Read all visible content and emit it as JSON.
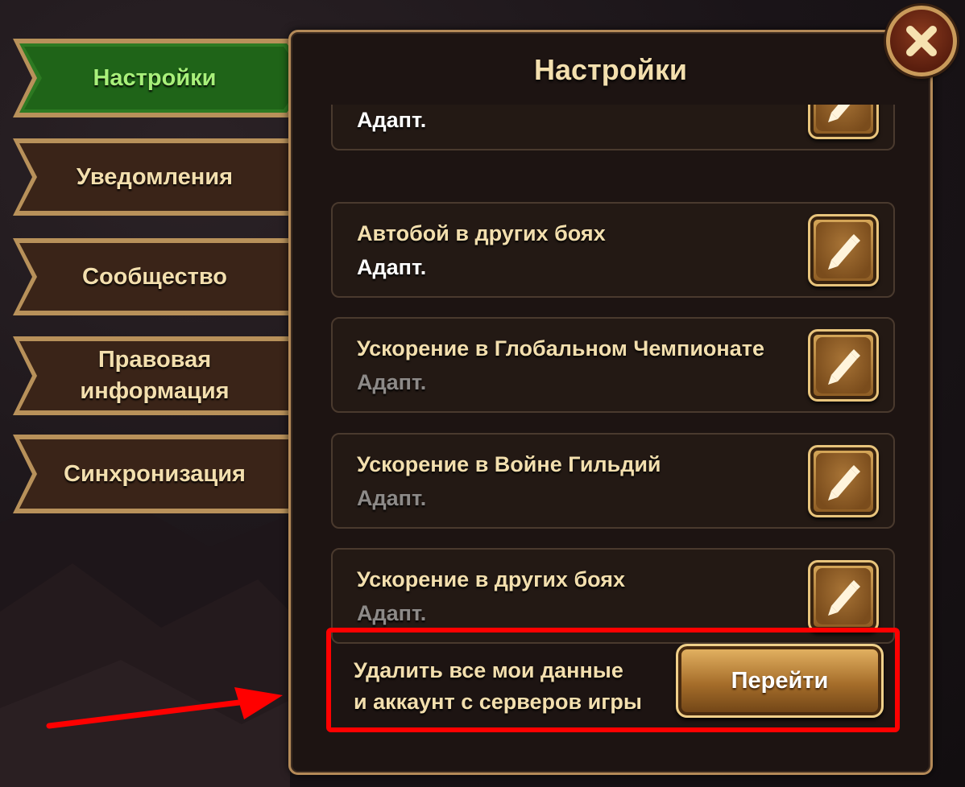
{
  "colors": {
    "accent_gold": "#f3dfae",
    "active_tab_green": "#a8f07a",
    "highlight_red": "#ff0000",
    "panel_bg": "#1d1412"
  },
  "sidebar": {
    "items": [
      {
        "label": "Настройки",
        "active": true
      },
      {
        "label": "Уведомления",
        "active": false
      },
      {
        "label": "Сообщество",
        "active": false
      },
      {
        "label": "Правовая информация",
        "active": false
      },
      {
        "label": "Синхронизация",
        "active": false
      }
    ]
  },
  "panel": {
    "title": "Настройки",
    "close_icon": "close-icon",
    "settings": [
      {
        "title": "",
        "value": "Адапт.",
        "value_dimmed": false,
        "icon": "pencil-icon"
      },
      {
        "title": "Автобой в других боях",
        "value": "Адапт.",
        "value_dimmed": false,
        "icon": "pencil-icon"
      },
      {
        "title": "Ускорение в Глобальном Чемпионате",
        "value": "Адапт.",
        "value_dimmed": true,
        "icon": "pencil-icon"
      },
      {
        "title": "Ускорение в Войне Гильдий",
        "value": "Адапт.",
        "value_dimmed": true,
        "icon": "pencil-icon"
      },
      {
        "title": "Ускорение в других боях",
        "value": "Адапт.",
        "value_dimmed": true,
        "icon": "pencil-icon"
      }
    ],
    "delete_account": {
      "label_line1": "Удалить все мои данные",
      "label_line2": "и аккаунт с серверов игры",
      "button_label": "Перейти"
    }
  }
}
